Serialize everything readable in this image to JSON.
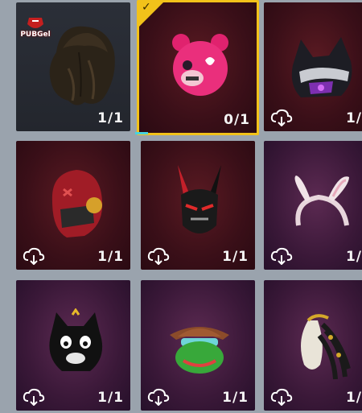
{
  "watermark": {
    "text": "PUBGel"
  },
  "tiles": [
    {
      "count": "1/1",
      "cloud": false,
      "selected": false,
      "item": "hair-icon"
    },
    {
      "count": "0/1",
      "cloud": false,
      "selected": true,
      "item": "pink-bear-mask-icon"
    },
    {
      "count": "1/",
      "cloud": true,
      "selected": false,
      "item": "cyber-cat-helmet-icon"
    },
    {
      "count": "1/1",
      "cloud": true,
      "selected": false,
      "item": "red-armor-helmet-icon"
    },
    {
      "count": "1/1",
      "cloud": true,
      "selected": false,
      "item": "demon-mask-icon"
    },
    {
      "count": "1/",
      "cloud": true,
      "selected": false,
      "item": "bunny-ears-headband-icon"
    },
    {
      "count": "1/1",
      "cloud": true,
      "selected": false,
      "item": "black-cat-mask-icon"
    },
    {
      "count": "1/1",
      "cloud": true,
      "selected": false,
      "item": "frog-hat-mask-icon"
    },
    {
      "count": "1/",
      "cloud": true,
      "selected": false,
      "item": "gold-dreadlocks-mask-icon"
    }
  ],
  "colors": {
    "selected_border": "#f2c21a",
    "indicator": "#46d3e0"
  }
}
